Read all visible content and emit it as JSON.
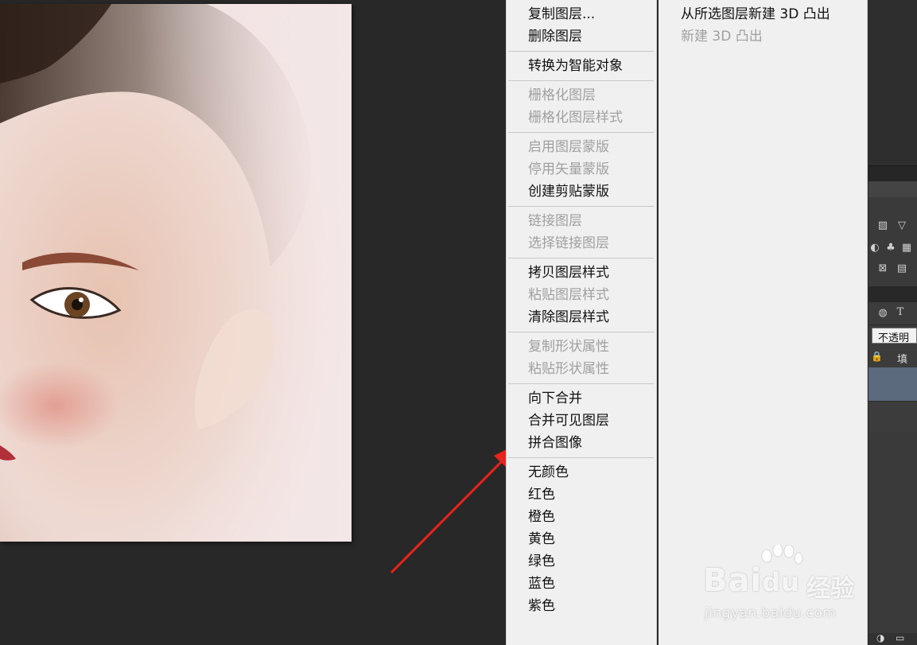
{
  "menu": {
    "groups": [
      [
        {
          "label": "复制图层...",
          "enabled": true
        },
        {
          "label": "删除图层",
          "enabled": true
        }
      ],
      [
        {
          "label": "转换为智能对象",
          "enabled": true
        }
      ],
      [
        {
          "label": "栅格化图层",
          "enabled": false
        },
        {
          "label": "栅格化图层样式",
          "enabled": false
        }
      ],
      [
        {
          "label": "启用图层蒙版",
          "enabled": false
        },
        {
          "label": "停用矢量蒙版",
          "enabled": false
        },
        {
          "label": "创建剪贴蒙版",
          "enabled": true
        }
      ],
      [
        {
          "label": "链接图层",
          "enabled": false
        },
        {
          "label": "选择链接图层",
          "enabled": false
        }
      ],
      [
        {
          "label": "拷贝图层样式",
          "enabled": true
        },
        {
          "label": "粘贴图层样式",
          "enabled": false
        },
        {
          "label": "清除图层样式",
          "enabled": true
        }
      ],
      [
        {
          "label": "复制形状属性",
          "enabled": false
        },
        {
          "label": "粘贴形状属性",
          "enabled": false
        }
      ],
      [
        {
          "label": "向下合并",
          "enabled": true
        },
        {
          "label": "合并可见图层",
          "enabled": true
        },
        {
          "label": "拼合图像",
          "enabled": true
        }
      ],
      [
        {
          "label": "无颜色",
          "enabled": true
        },
        {
          "label": "红色",
          "enabled": true
        },
        {
          "label": "橙色",
          "enabled": true
        },
        {
          "label": "黄色",
          "enabled": true
        },
        {
          "label": "绿色",
          "enabled": true
        },
        {
          "label": "蓝色",
          "enabled": true
        },
        {
          "label": "紫色",
          "enabled": true
        }
      ]
    ]
  },
  "submenu": {
    "items": [
      {
        "label": "从所选图层新建 3D 凸出",
        "enabled": true
      },
      {
        "label": "新建 3D 凸出",
        "enabled": false
      }
    ]
  },
  "layers_panel": {
    "opacity_label": "不透明度",
    "fill_label": "填充",
    "type_icon": "T"
  },
  "watermark": {
    "brand": "Bai",
    "brand2": "du",
    "cn": "经验",
    "url": "jingyan.baidu.com"
  },
  "colors": {
    "annotation_arrow": "#e8231b",
    "menu_bg": "#f0f0f0",
    "canvas_bg": "#282828"
  }
}
